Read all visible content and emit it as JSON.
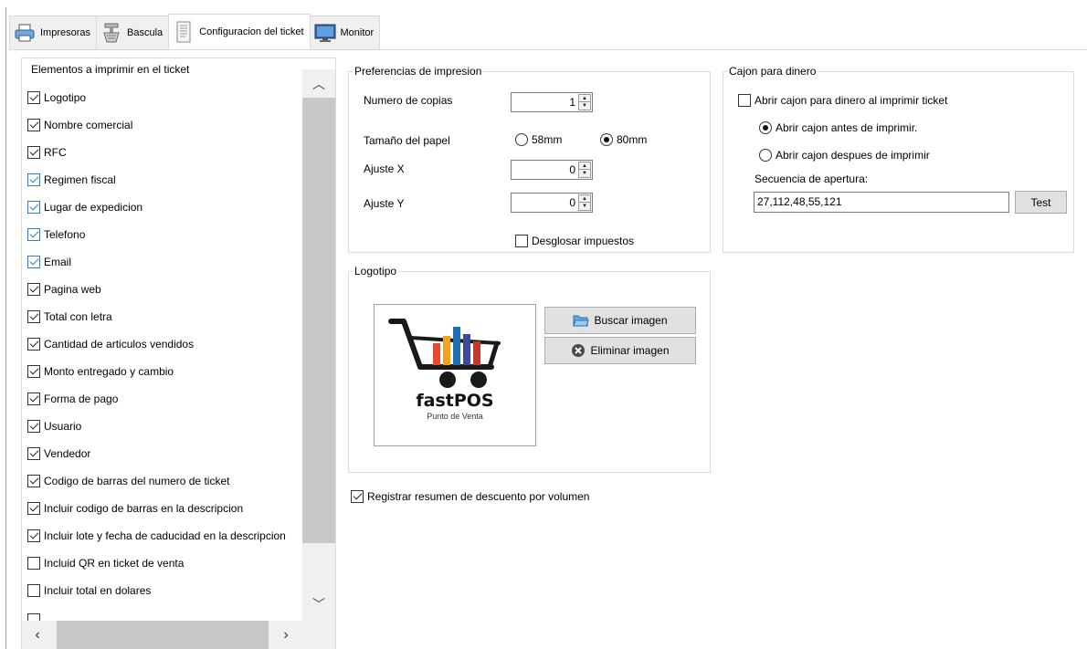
{
  "tabs": [
    {
      "label": "Impresoras",
      "icon": "printer-icon",
      "active": false
    },
    {
      "label": "Bascula",
      "icon": "scale-icon",
      "active": false
    },
    {
      "label": "Configuracion del ticket",
      "icon": "ticket-icon",
      "active": true
    },
    {
      "label": "Monitor",
      "icon": "monitor-icon",
      "active": false
    }
  ],
  "elements_group": {
    "title": "Elementos a imprimir en el ticket",
    "items": [
      {
        "label": "Logotipo",
        "checked": true,
        "style": "dark"
      },
      {
        "label": "Nombre comercial",
        "checked": true,
        "style": "dark"
      },
      {
        "label": "RFC",
        "checked": true,
        "style": "dark"
      },
      {
        "label": "Regimen fiscal",
        "checked": true,
        "style": "blue"
      },
      {
        "label": "Lugar de expedicion",
        "checked": true,
        "style": "blue"
      },
      {
        "label": "Telefono",
        "checked": true,
        "style": "blue"
      },
      {
        "label": "Email",
        "checked": true,
        "style": "blue"
      },
      {
        "label": "Pagina web",
        "checked": true,
        "style": "dark"
      },
      {
        "label": "Total con letra",
        "checked": true,
        "style": "dark"
      },
      {
        "label": "Cantidad de articulos vendidos",
        "checked": true,
        "style": "dark"
      },
      {
        "label": "Monto entregado y cambio",
        "checked": true,
        "style": "dark"
      },
      {
        "label": "Forma de pago",
        "checked": true,
        "style": "dark"
      },
      {
        "label": "Usuario",
        "checked": true,
        "style": "dark"
      },
      {
        "label": "Vendedor",
        "checked": true,
        "style": "dark"
      },
      {
        "label": "Codigo de barras del numero de ticket",
        "checked": true,
        "style": "dark"
      },
      {
        "label": "Incluir codigo de barras en la descripcion",
        "checked": true,
        "style": "dark"
      },
      {
        "label": "Incluir lote y fecha de caducidad en la descripcion",
        "checked": true,
        "style": "dark"
      },
      {
        "label": "Incluid QR en ticket de venta",
        "checked": false,
        "style": "dark"
      },
      {
        "label": "Incluir total en dolares",
        "checked": false,
        "style": "dark"
      },
      {
        "label": "",
        "checked": false,
        "style": "dark"
      }
    ]
  },
  "print_prefs": {
    "title": "Preferencias de impresion",
    "copies_label": "Numero de copias",
    "copies_value": "1",
    "paper_label": "Tamaño del papel",
    "paper_options": [
      "58mm",
      "80mm"
    ],
    "paper_selected": "80mm",
    "adjust_x_label": "Ajuste X",
    "adjust_x_value": "0",
    "adjust_y_label": "Ajuste Y",
    "adjust_y_value": "0",
    "breakdown_tax_label": "Desglosar impuestos",
    "breakdown_tax_checked": false
  },
  "cash_drawer": {
    "title": "Cajon para dinero",
    "open_on_print_label": "Abrir cajon para dinero al imprimir ticket",
    "open_on_print_checked": false,
    "before_label": "Abrir cajon antes de imprimir.",
    "after_label": "Abrir cajon despues de imprimir",
    "selected": "before",
    "sequence_label": "Secuencia de apertura:",
    "sequence_value": "27,112,48,55,121",
    "test_button": "Test"
  },
  "logo_group": {
    "title": "Logotipo",
    "brand_name": "fastPOS",
    "brand_sub": "Punto de Venta",
    "search_button": "Buscar imagen",
    "delete_button": "Eliminar imagen"
  },
  "discount_summary": {
    "label": "Registrar resumen de descuento por volumen",
    "checked": true
  },
  "colors": {
    "accent_blue": "#2c7cd6",
    "logo_bars": [
      "#e84a2f",
      "#f3a31b",
      "#1f6fb5",
      "#3a4aa0",
      "#c0392b"
    ]
  }
}
